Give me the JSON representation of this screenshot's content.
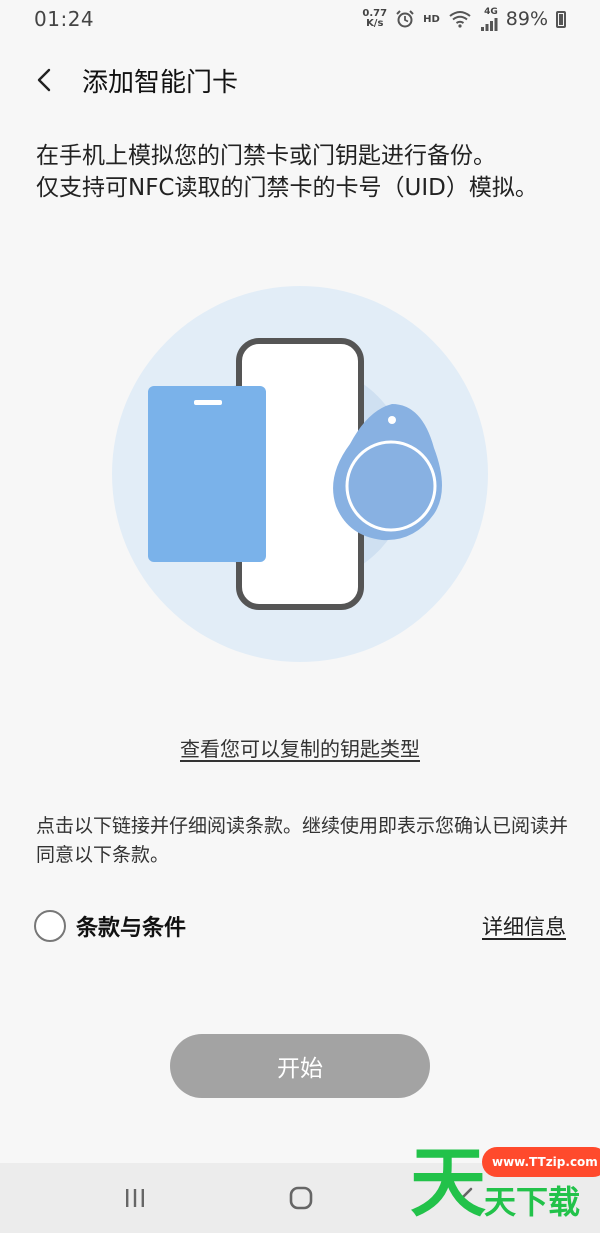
{
  "status_bar": {
    "time": "01:24",
    "speed_value": "0.77",
    "speed_unit": "K/s",
    "hd": "HD",
    "network": "4G",
    "battery": "89%"
  },
  "header": {
    "back_icon": "back-arrow-icon",
    "title": "添加智能门卡"
  },
  "intro": {
    "line1": "在手机上模拟您的门禁卡或门钥匙进行备份。",
    "line2": "仅支持可NFC读取的门禁卡的卡号（UID）模拟。"
  },
  "illustration": {
    "icon": "phone-card-keyfob-illustration",
    "colors": {
      "outer_circle": "#e2edf7",
      "inner_circle": "#cfe0f1",
      "card": "#7ab2ea",
      "phone_border": "#555555",
      "keyfob": "#88b1e2"
    }
  },
  "links": {
    "key_types": "查看您可以复制的钥匙类型"
  },
  "terms": {
    "description": "点击以下链接并仔细阅读条款。继续使用即表示您确认已阅读并同意以下条款。",
    "checkbox_label": "条款与条件",
    "details_link": "详细信息",
    "checked": false
  },
  "actions": {
    "start_label": "开始",
    "start_color": "#a3a3a3"
  },
  "nav_bar": {
    "recent_icon": "recent-apps-icon",
    "home_icon": "home-icon",
    "back_icon": "back-icon"
  },
  "watermark": {
    "url": "www.TTzip.com",
    "big_char": "天",
    "small_text": "天下载",
    "color": "#22c24a"
  }
}
